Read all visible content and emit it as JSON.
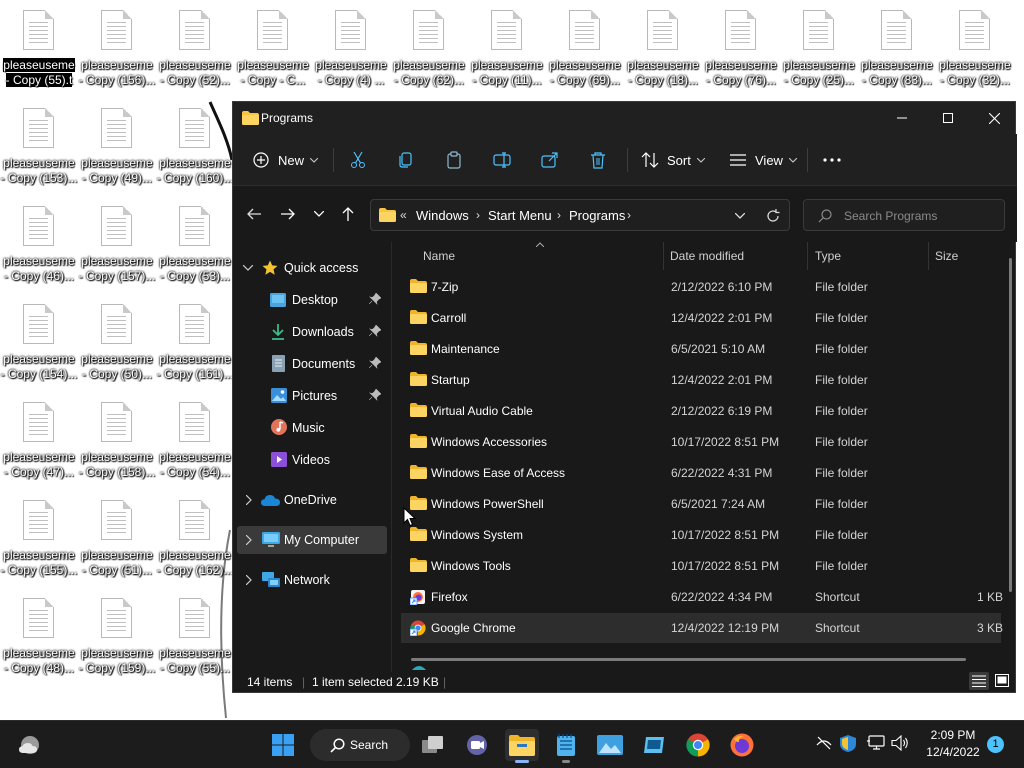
{
  "desktop": {
    "icons": [
      [
        "pleaseuseme",
        "- Copy (55).t"
      ],
      [
        "pleaseuseme",
        "- Copy (156)..."
      ],
      [
        "pleaseuseme",
        "- Copy (52)..."
      ],
      [
        "pleaseuseme",
        "- Copy - C..."
      ],
      [
        "pleaseuseme",
        "- Copy (4) ..."
      ],
      [
        "pleaseuseme",
        "- Copy (62)..."
      ],
      [
        "pleaseuseme",
        "- Copy (11)..."
      ],
      [
        "pleaseuseme",
        "- Copy (69)..."
      ],
      [
        "pleaseuseme",
        "- Copy (18)..."
      ],
      [
        "pleaseuseme",
        "- Copy (76)..."
      ],
      [
        "pleaseuseme",
        "- Copy (25)..."
      ],
      [
        "pleaseuseme",
        "- Copy (83)..."
      ],
      [
        "pleaseuseme",
        "- Copy (32)..."
      ],
      [
        "pleaseuseme",
        "- Copy (153)..."
      ],
      [
        "pleaseuseme",
        "- Copy (49)..."
      ],
      [
        "pleaseuseme",
        "- Copy (160)..."
      ],
      [
        "pleaseuseme",
        "- Copy (46)..."
      ],
      [
        "pleaseuseme",
        "- Copy (157)..."
      ],
      [
        "pleaseuseme",
        "- Copy (53)..."
      ],
      [
        "pleaseuseme",
        "- Copy (154)..."
      ],
      [
        "pleaseuseme",
        "- Copy (50)..."
      ],
      [
        "pleaseuseme",
        "- Copy (161)..."
      ],
      [
        "pleaseuseme",
        "- Copy (47)..."
      ],
      [
        "pleaseuseme",
        "- Copy (158)..."
      ],
      [
        "pleaseuseme",
        "- Copy (54)..."
      ],
      [
        "pleaseuseme",
        "- Copy (155)..."
      ],
      [
        "pleaseuseme",
        "- Copy (51)..."
      ],
      [
        "pleaseuseme",
        "- Copy (162)..."
      ],
      [
        "pleaseuseme",
        "- Copy (48)..."
      ],
      [
        "pleaseuseme",
        "- Copy (159)..."
      ],
      [
        "pleaseuseme",
        "- Copy (55)..."
      ]
    ]
  },
  "window": {
    "title": "Programs",
    "commands": {
      "new": "New",
      "sort": "Sort",
      "view": "View"
    },
    "address": {
      "root_chevron": "«",
      "crumbs": [
        "Windows",
        "Start Menu",
        "Programs"
      ]
    },
    "search_placeholder": "Search Programs",
    "sidebar": {
      "quick_access": "Quick access",
      "items": [
        "Desktop",
        "Downloads",
        "Documents",
        "Pictures",
        "Music",
        "Videos"
      ],
      "onedrive": "OneDrive",
      "my_computer": "My Computer",
      "network": "Network"
    },
    "columns": {
      "name": "Name",
      "date": "Date modified",
      "type": "Type",
      "size": "Size"
    },
    "rows": [
      {
        "name": "7-Zip",
        "date": "2/12/2022 6:10 PM",
        "type": "File folder",
        "size": "",
        "icon": "folder"
      },
      {
        "name": "Carroll",
        "date": "12/4/2022 2:01 PM",
        "type": "File folder",
        "size": "",
        "icon": "folder"
      },
      {
        "name": "Maintenance",
        "date": "6/5/2021 5:10 AM",
        "type": "File folder",
        "size": "",
        "icon": "folder"
      },
      {
        "name": "Startup",
        "date": "12/4/2022 2:01 PM",
        "type": "File folder",
        "size": "",
        "icon": "folder"
      },
      {
        "name": "Virtual Audio Cable",
        "date": "2/12/2022 6:19 PM",
        "type": "File folder",
        "size": "",
        "icon": "folder"
      },
      {
        "name": "Windows Accessories",
        "date": "10/17/2022 8:51 PM",
        "type": "File folder",
        "size": "",
        "icon": "folder"
      },
      {
        "name": "Windows Ease of Access",
        "date": "6/22/2022 4:31 PM",
        "type": "File folder",
        "size": "",
        "icon": "folder"
      },
      {
        "name": "Windows PowerShell",
        "date": "6/5/2021 7:24 AM",
        "type": "File folder",
        "size": "",
        "icon": "folder"
      },
      {
        "name": "Windows System",
        "date": "10/17/2022 8:51 PM",
        "type": "File folder",
        "size": "",
        "icon": "folder"
      },
      {
        "name": "Windows Tools",
        "date": "10/17/2022 8:51 PM",
        "type": "File folder",
        "size": "",
        "icon": "folder"
      },
      {
        "name": "Firefox",
        "date": "6/22/2022 4:34 PM",
        "type": "Shortcut",
        "size": "1 KB",
        "icon": "firefox-shortcut"
      },
      {
        "name": "Google Chrome",
        "date": "12/4/2022 12:19 PM",
        "type": "Shortcut",
        "size": "3 KB",
        "icon": "chrome-shortcut",
        "selected": true
      }
    ],
    "status": {
      "items": "14 items",
      "selected": "1 item selected",
      "size": "2.19 KB"
    }
  },
  "taskbar": {
    "search_label": "Search",
    "time": "2:09 PM",
    "date": "12/4/2022",
    "notifications": "1"
  },
  "colors": {
    "accent": "#4cc2ff",
    "folder": "#f8c542",
    "window_bg": "#191919"
  }
}
